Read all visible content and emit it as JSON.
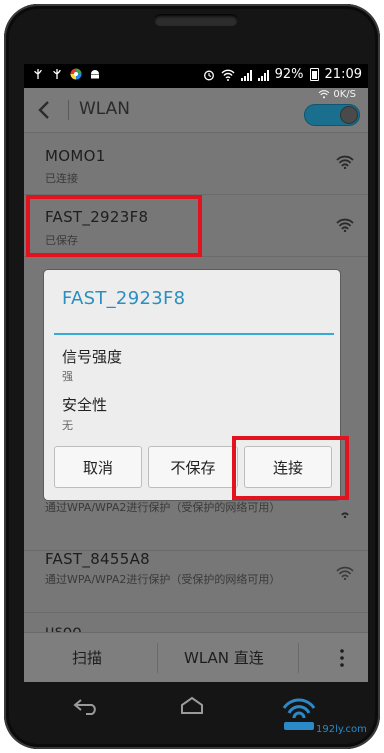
{
  "status_bar": {
    "left_icons": [
      "usb-icon",
      "usb-icon",
      "color-app-icon",
      "android-icon"
    ],
    "right_icons": [
      "alarm-icon",
      "wifi-icon",
      "signal-icon",
      "signal-icon"
    ],
    "battery": "92%",
    "time": "21:09",
    "speed": "0K/S"
  },
  "action_bar": {
    "title": "WLAN",
    "toggle_on": true
  },
  "networks": [
    {
      "name": "MOMO1",
      "status": "已连接"
    },
    {
      "name": "FAST_2923F8",
      "status": "已保存"
    },
    {
      "name": "",
      "status": "通过WPA/WPA2进行保护（受保护的网络可用）"
    },
    {
      "name": "FAST_8455A8",
      "status": "通过WPA/WPA2进行保护（受保护的网络可用）"
    },
    {
      "name": "usoo",
      "status": ""
    }
  ],
  "dialog": {
    "title": "FAST_2923F8",
    "signal_label": "信号强度",
    "signal_value": "强",
    "security_label": "安全性",
    "security_value": "无",
    "cancel": "取消",
    "no_save": "不保存",
    "connect": "连接"
  },
  "bottom_bar": {
    "scan": "扫描",
    "wlan_direct": "WLAN 直连"
  },
  "watermark": "192ly.com",
  "colors": {
    "accent": "#2a8fc0",
    "highlight": "#e3121f",
    "toggle": "#1a6e8e"
  }
}
